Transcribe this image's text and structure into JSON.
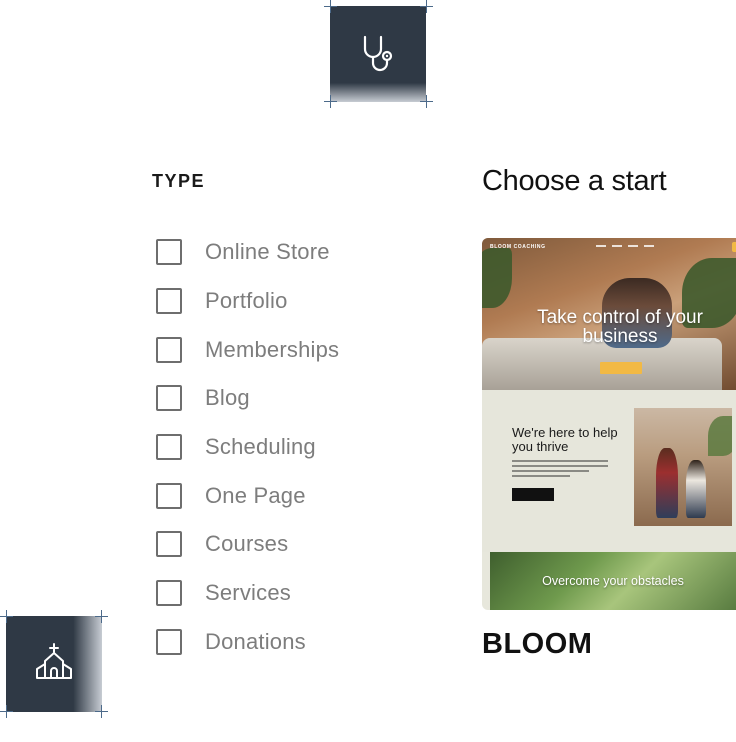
{
  "icons": {
    "top_tile_icon": "stethoscope-icon",
    "bottom_tile_icon": "church-icon",
    "tile_color": "#2f3945",
    "corner_mark_color": "#4c6a8a"
  },
  "filters": {
    "heading": "TYPE",
    "items": [
      {
        "label": "Online Store",
        "checked": false
      },
      {
        "label": "Portfolio",
        "checked": false
      },
      {
        "label": "Memberships",
        "checked": false
      },
      {
        "label": "Blog",
        "checked": false
      },
      {
        "label": "Scheduling",
        "checked": false
      },
      {
        "label": "One Page",
        "checked": false
      },
      {
        "label": "Courses",
        "checked": false
      },
      {
        "label": "Services",
        "checked": false
      },
      {
        "label": "Donations",
        "checked": false
      }
    ]
  },
  "main": {
    "heading": "Choose a start",
    "template": {
      "name": "BLOOM",
      "preview": {
        "brand": "BLOOM COACHING",
        "hero_title": "Take control of your business",
        "section_title": "We're here to help you thrive",
        "footer_text": "Overcome your obstacles",
        "accent_color": "#f2b944"
      }
    }
  }
}
